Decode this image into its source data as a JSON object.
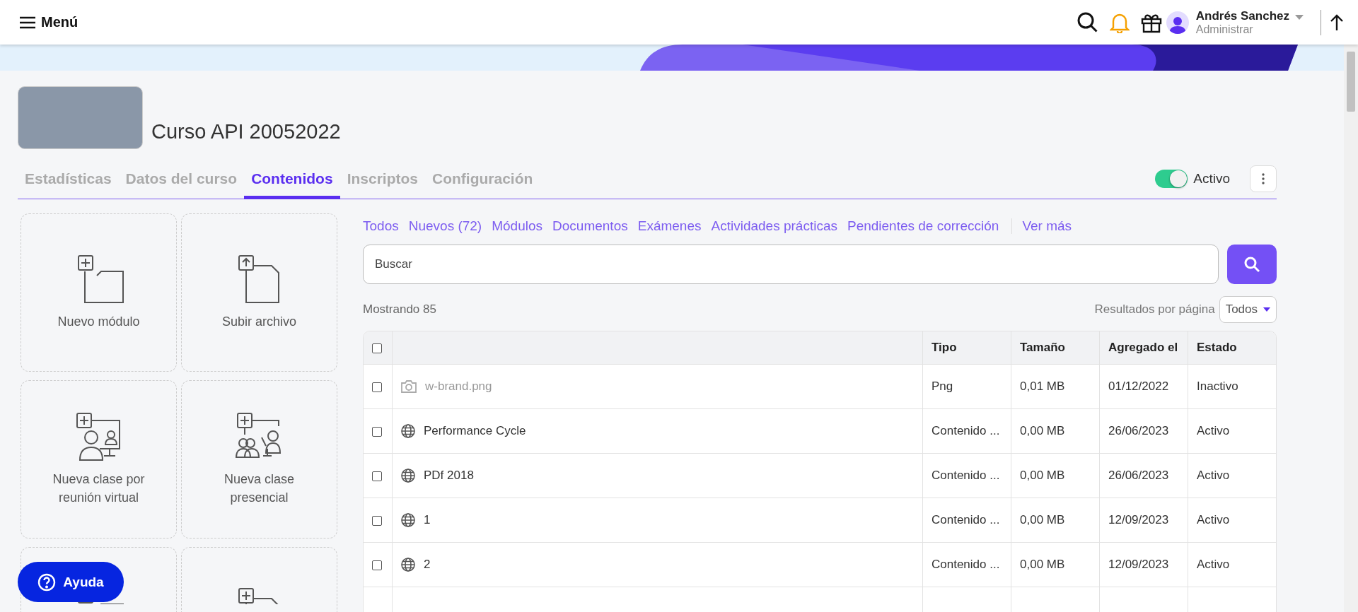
{
  "header": {
    "menu_label": "Menú",
    "user": {
      "name": "Andrés Sanchez",
      "role": "Administrar"
    }
  },
  "course": {
    "title": "Curso API 20052022"
  },
  "tabs": [
    {
      "label": "Estadísticas",
      "selected": false
    },
    {
      "label": "Datos del curso",
      "selected": false
    },
    {
      "label": "Contenidos",
      "selected": true
    },
    {
      "label": "Inscriptos",
      "selected": false
    },
    {
      "label": "Configuración",
      "selected": false
    }
  ],
  "status_toggle": {
    "label": "Activo",
    "on": true
  },
  "actions": [
    {
      "kind": "module",
      "label": "Nuevo módulo"
    },
    {
      "kind": "upload",
      "label": "Subir archivo"
    },
    {
      "kind": "virtual",
      "label": "Nueva clase por reunión virtual"
    },
    {
      "kind": "classroom",
      "label": "Nueva clase presencial"
    },
    {
      "kind": "module"
    },
    {
      "kind": "file"
    }
  ],
  "filters": [
    "Todos",
    "Nuevos (72)",
    "Módulos",
    "Documentos",
    "Exámenes",
    "Actividades prácticas",
    "Pendientes de corrección"
  ],
  "more_link": "Ver más",
  "search": {
    "placeholder": "Buscar"
  },
  "showing": "Mostrando 85",
  "per_page": {
    "label": "Resultados por página",
    "value": "Todos"
  },
  "table": {
    "select_all_checked": false,
    "columns": [
      "Tipo",
      "Tamaño",
      "Agregado el",
      "Estado"
    ],
    "rows": [
      {
        "kind": "image",
        "active": false,
        "checked": false,
        "name": "w-brand.png",
        "type": "Png",
        "size": "0,01 MB",
        "added": "01/12/2022",
        "status": "Inactivo"
      },
      {
        "kind": "web",
        "active": true,
        "checked": false,
        "name": "Performance Cycle",
        "type": "Contenido ...",
        "size": "0,00 MB",
        "added": "26/06/2023",
        "status": "Activo"
      },
      {
        "kind": "web",
        "active": true,
        "checked": false,
        "name": "PDf 2018",
        "type": "Contenido ...",
        "size": "0,00 MB",
        "added": "26/06/2023",
        "status": "Activo"
      },
      {
        "kind": "web",
        "active": true,
        "checked": false,
        "name": "1",
        "type": "Contenido ...",
        "size": "0,00 MB",
        "added": "12/09/2023",
        "status": "Activo"
      },
      {
        "kind": "web",
        "active": true,
        "checked": false,
        "name": "2",
        "type": "Contenido ...",
        "size": "0,00 MB",
        "added": "12/09/2023",
        "status": "Activo"
      }
    ]
  },
  "help_button": "Ayuda"
}
